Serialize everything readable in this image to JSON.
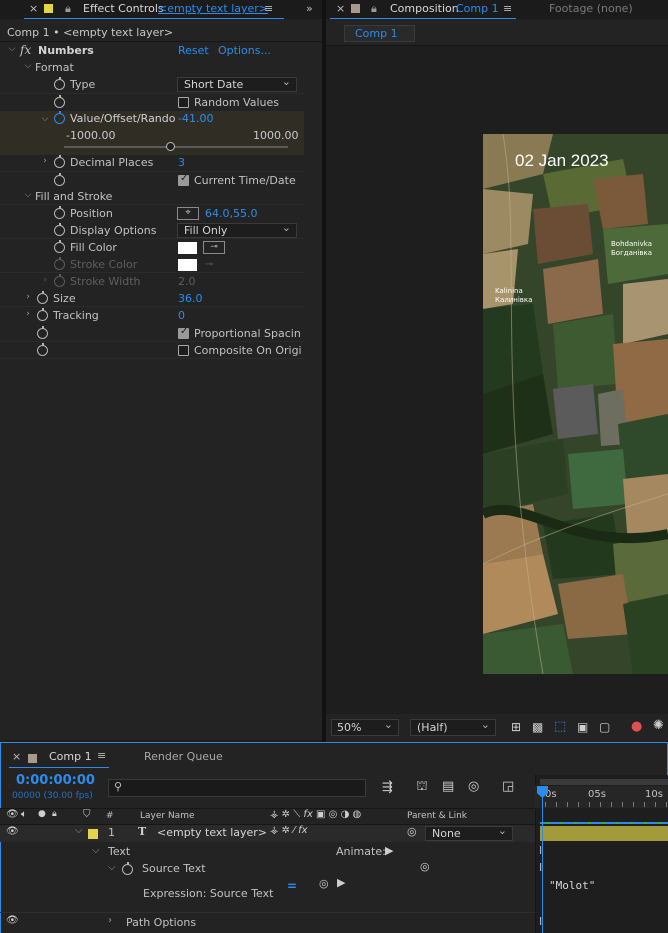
{
  "effect_controls": {
    "tab_title": "Effect Controls",
    "tab_layer": "<empty text layer>",
    "breadcrumb": "Comp 1 • <empty text layer>",
    "effect_name": "Numbers",
    "reset_label": "Reset",
    "options_label": "Options...",
    "format_group": "Format",
    "type_label": "Type",
    "type_value": "Short Date",
    "random_values_label": "Random Values",
    "value_label": "Value/Offset/Rando",
    "value_value": "-41.00",
    "slider_min": "-1000.00",
    "slider_max": "1000.00",
    "slider_value": 0.479,
    "decimal_places_label": "Decimal Places",
    "decimal_places_value": "3",
    "current_time_label": "Current Time/Date",
    "fill_stroke_group": "Fill and Stroke",
    "position_label": "Position",
    "position_value": "64.0,55.0",
    "display_options_label": "Display Options",
    "display_options_value": "Fill Only",
    "fill_color_label": "Fill Color",
    "stroke_color_label": "Stroke Color",
    "stroke_width_label": "Stroke Width",
    "stroke_width_value": "2.0",
    "size_label": "Size",
    "size_value": "36.0",
    "tracking_label": "Tracking",
    "tracking_value": "0",
    "proportional_label": "Proportional Spacin",
    "composite_label": "Composite On Origi"
  },
  "composition": {
    "tab_title": "Composition",
    "tab_comp": "Comp 1",
    "footage_label": "Footage (none)",
    "comp_button": "Comp 1",
    "overlay_date": "02 Jan 2023",
    "map_label_1a": "Bohdanivka",
    "map_label_1b": "Богданівка",
    "map_label_2a": "Kalinina",
    "map_label_2b": "Калинівка",
    "zoom_value": "50%",
    "resolution_value": "(Half)"
  },
  "timeline": {
    "tab_title": "Comp 1",
    "render_queue_label": "Render Queue",
    "timecode": "0:00:00:00",
    "frame_info": "00000 (30.00 fps)",
    "search_placeholder": "",
    "col_hash": "#",
    "col_layer_name": "Layer Name",
    "col_parent": "Parent & Link",
    "ruler_0": "0s",
    "ruler_5": "05s",
    "ruler_10": "10s",
    "layer_num": "1",
    "layer_name": "<empty text layer>",
    "parent_value": "None",
    "text_group": "Text",
    "animate_label": "Animate:",
    "source_text_label": "Source Text",
    "expression_label": "Expression: Source Text",
    "expression_value": "\"Molot\"",
    "path_options_label": "Path Options"
  },
  "colors": {
    "accent_blue": "#2d8ceb",
    "layer_yellow": "#e4d44b",
    "track_olive": "#a39a3c"
  }
}
